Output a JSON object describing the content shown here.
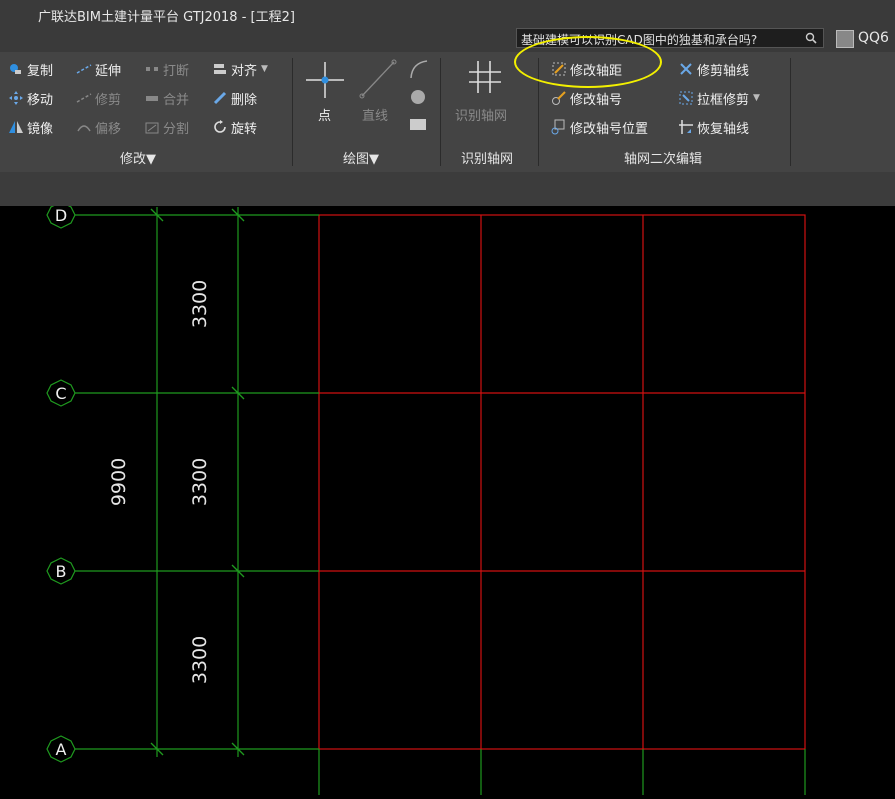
{
  "window": {
    "title": "广联达BIM土建计量平台 GTJ2018 - [工程2]"
  },
  "search": {
    "text": "基础建模可以识别CAD图中的独基和承台吗?"
  },
  "account": {
    "name": "QQ6"
  },
  "ribbon": {
    "modify": {
      "label": "修改",
      "copy": "复制",
      "extend": "延伸",
      "break": "打断",
      "align": "对齐",
      "move": "移动",
      "trim": "修剪",
      "merge": "合并",
      "delete": "删除",
      "mirror": "镜像",
      "offset": "偏移",
      "split": "分割",
      "rotate": "旋转"
    },
    "draw": {
      "label": "绘图",
      "point": "点",
      "line": "直线"
    },
    "recognize": {
      "label": "识别轴网",
      "button": "识别轴网"
    },
    "axis_edit": {
      "label": "轴网二次编辑",
      "modify_spacing": "修改轴距",
      "trim_axis": "修剪轴线",
      "modify_number": "修改轴号",
      "box_trim": "拉框修剪",
      "modify_number_pos": "修改轴号位置",
      "restore_axis": "恢复轴线"
    }
  },
  "canvas": {
    "axes": [
      "D",
      "C",
      "B",
      "A"
    ],
    "dimensions": {
      "seg_dc": "3300",
      "seg_cb": "3300",
      "seg_ba": "3300",
      "total": "9900"
    }
  },
  "colors": {
    "axis_green": "#1f9a1f",
    "grid_red": "#d01010",
    "highlight": "#f3f000"
  }
}
